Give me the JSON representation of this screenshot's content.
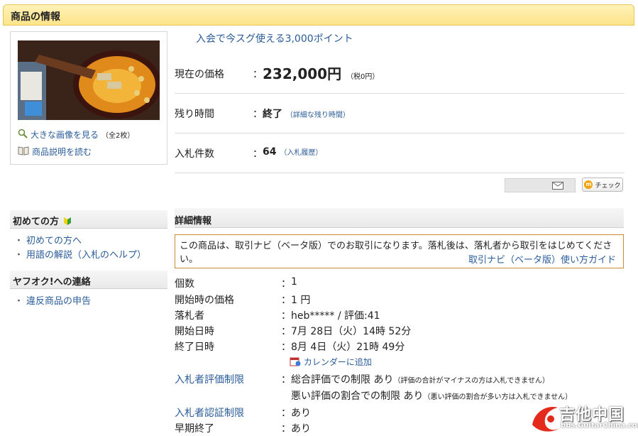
{
  "header": {
    "title": "商品の情報"
  },
  "image_panel": {
    "large_image_link": "大きな画像を見る",
    "image_count": "（全2枚）",
    "description_link": "商品説明を読む"
  },
  "promo": {
    "text": "入会で今スグ使える3,000ポイント"
  },
  "price": {
    "label": "現在の価格",
    "colon": "：",
    "value": "232,000円",
    "tax": "（税0円）"
  },
  "time_left": {
    "label": "残り時間",
    "colon": "：",
    "value": "終了",
    "detail_link": "（詳細な残り時間）"
  },
  "bids": {
    "label": "入札件数",
    "colon": "：",
    "value": "64",
    "history_link": "（入札履歴）"
  },
  "actions": {
    "check_label": "チェック"
  },
  "sidebar": {
    "beginner_heading": "初めての方",
    "beginner_items": [
      "初めての方へ",
      "用語の解説（入札のヘルプ）"
    ],
    "contact_heading": "ヤフオク!への連絡",
    "contact_items": [
      "違反商品の申告"
    ],
    "bullet": "・"
  },
  "details": {
    "heading": "詳細情報",
    "notice_text": "この商品は、取引ナビ（ベータ版）でのお取引になります。落札後は、落札者から取引をはじめてください。",
    "notice_link": "取引ナビ（ベータ版）使い方ガイド",
    "colon": "：",
    "rows": {
      "quantity": {
        "label": "個数",
        "value": "1"
      },
      "start_price": {
        "label": "開始時の価格",
        "value": "1 円"
      },
      "winner": {
        "label": "落札者",
        "value": "heb***** / 評価:41"
      },
      "start_date": {
        "label": "開始日時",
        "value": "7月 28日（火）14時 52分"
      },
      "end_date": {
        "label": "終了日時",
        "value": "8月 4日（火）21時 49分"
      },
      "calendar_link": "カレンダーに追加",
      "rating_limit": {
        "label": "入札者評価制限",
        "value1": "総合評価での制限 あり",
        "note1": "（評価の合計がマイナスの方は入札できません）",
        "value2": "悪い評価の割合での制限 あり",
        "note2": "（悪い評価の割合が多い方は入札できません）"
      },
      "auth_limit": {
        "label": "入札者認証制限",
        "value": "あり"
      },
      "early_end": {
        "label": "早期終了",
        "value": "あり"
      }
    }
  },
  "watermark": {
    "text": "吉他中国",
    "url": "bbs.GuitarChina.com"
  },
  "colors": {
    "link": "#2a5c9a",
    "header_bg": "#fde48a",
    "notice_border": "#d08a2c"
  }
}
